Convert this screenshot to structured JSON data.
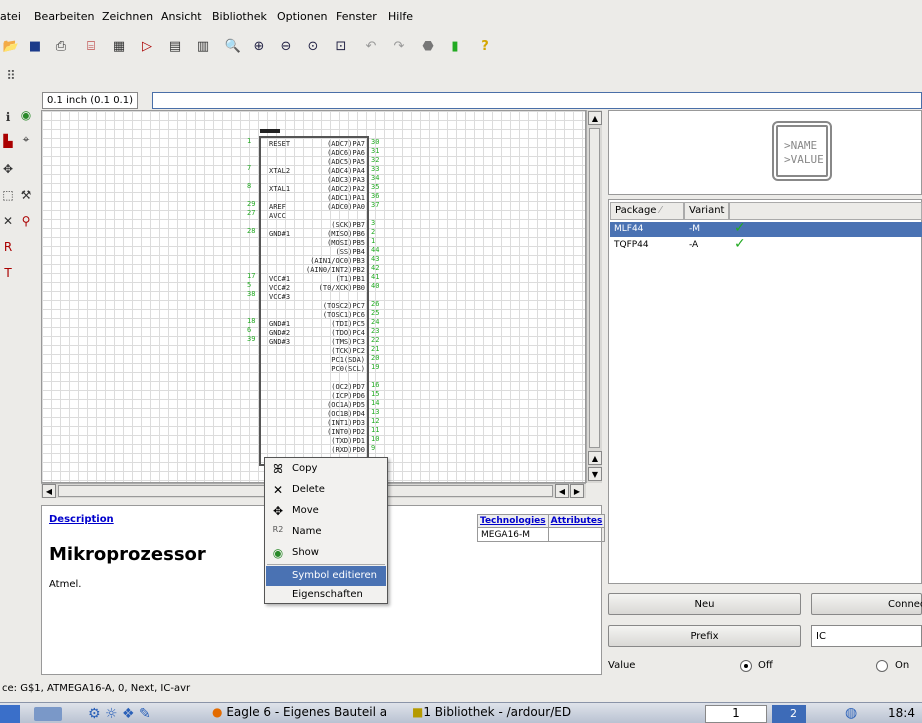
{
  "menu": [
    "atei",
    "Bearbeiten",
    "Zeichnen",
    "Ansicht",
    "Bibliothek",
    "Optionen",
    "Fenster",
    "Hilfe"
  ],
  "grid": {
    "value": "0.1 inch (0.1 0.1)"
  },
  "chip": {
    "left_pins": [
      "RESET",
      "XTAL2",
      "XTAL1",
      "AREF",
      "AVCC",
      "GND#1",
      "VCC#1",
      "VCC#2",
      "VCC#3",
      "GND#1",
      "GND#2",
      "GND#3"
    ],
    "left_nums": [
      "1",
      "7",
      "8",
      "29",
      "27",
      "28",
      "17",
      "5",
      "38",
      "18",
      "6",
      "39"
    ],
    "right_pins": [
      "(ADC7)PA7",
      "(ADC6)PA6",
      "(ADC5)PA5",
      "(ADC4)PA4",
      "(ADC3)PA3",
      "(ADC2)PA2",
      "(ADC1)PA1",
      "(ADC0)PA0",
      "(SCK)PB7",
      "(MISO)PB6",
      "(MOSI)PB5",
      "(SS)PB4",
      "(AIN1/OC0)PB3",
      "(AIN0/INT2)PB2",
      "(T1)PB1",
      "(T0/XCK)PB0",
      "(TOSC2)PC7",
      "(TOSC1)PC6",
      "(TDI)PC5",
      "(TDO)PC4",
      "(TMS)PC3",
      "(TCK)PC2",
      "PC1(SDA)",
      "PC0(SCL)",
      "(OC2)PD7",
      "(ICP)PD6",
      "(OC1A)PD5",
      "(OC1B)PD4",
      "(INT1)PD3",
      "(INT0)PD2",
      "(TXD)PD1",
      "(RXD)PD0"
    ],
    "right_nums": [
      "30",
      "31",
      "32",
      "33",
      "34",
      "35",
      "36",
      "37",
      "3",
      "2",
      "1",
      "44",
      "43",
      "42",
      "41",
      "40",
      "26",
      "25",
      "24",
      "23",
      "22",
      "21",
      "20",
      "19",
      "16",
      "15",
      "14",
      "13",
      "12",
      "11",
      "10",
      "9"
    ]
  },
  "description": {
    "link": "Description",
    "title": "Mikroprozessor",
    "text": "Atmel.",
    "tech_headers": [
      "Technologies",
      "Attributes"
    ],
    "tech_row": [
      "MEGA16-M",
      ""
    ]
  },
  "preview": {
    "line1": ">NAME",
    "line2": ">VALUE"
  },
  "packages": {
    "headers": [
      "Package",
      "Variant"
    ],
    "rows": [
      {
        "package": "MLF44",
        "variant": "-M",
        "selected": true
      },
      {
        "package": "TQFP44",
        "variant": "-A",
        "selected": false
      }
    ]
  },
  "buttons": {
    "new": "Neu",
    "connect": "Connect",
    "prefix": "Prefix",
    "prefix_value": "IC"
  },
  "value": {
    "label": "Value",
    "off": "Off",
    "on": "On"
  },
  "context_menu": [
    {
      "label": "Copy",
      "icon": "copy-icon",
      "glyph": "ꕤ"
    },
    {
      "label": "Delete",
      "icon": "delete-icon",
      "glyph": "✕"
    },
    {
      "label": "Move",
      "icon": "move-icon",
      "glyph": "✥"
    },
    {
      "label": "Name",
      "icon": "name-icon",
      "glyph": "R2"
    },
    {
      "label": "Show",
      "icon": "eye-icon",
      "glyph": "◉"
    },
    {
      "label": "Symbol editieren",
      "icon": "",
      "glyph": "",
      "highlight": true
    },
    {
      "label": "Eigenschaften",
      "icon": "",
      "glyph": ""
    }
  ],
  "status": "ce: G$1, ATMEGA16-A, 0, Next, IC-avr",
  "taskbar": {
    "task1": "Eagle 6 - Eigenes Bauteil a",
    "task2": "1 Bibliothek - /ardour/ED",
    "desktop": "1",
    "workspace": "2",
    "clock": "18:4"
  },
  "colors": {
    "selection": "#4a72b3",
    "link": "#0000cc",
    "pin_circle": "#33aa33"
  }
}
